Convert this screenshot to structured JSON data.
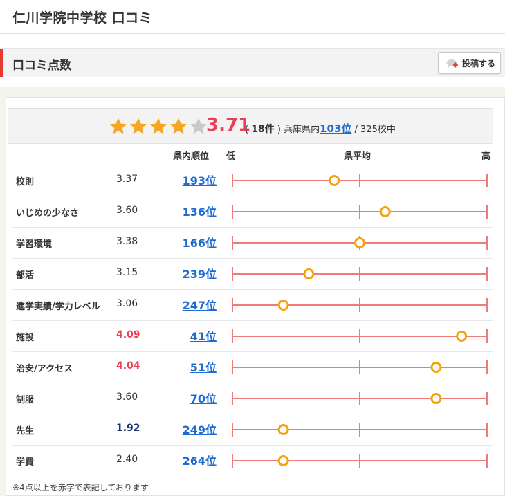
{
  "page": {
    "title": "仁川学院中学校 口コミ"
  },
  "section": {
    "title": "口コミ点数",
    "post_button_label": "投稿する"
  },
  "summary": {
    "star_rating": 3.71,
    "score": "3.71",
    "count_open": "(",
    "count": "18件",
    "count_close": ")",
    "prefecture": "兵庫県内",
    "rank": "103位",
    "total": "/ 325校中"
  },
  "columns": {
    "rank": "県内順位",
    "low": "低",
    "average": "県平均",
    "high": "高"
  },
  "colors": {
    "high_score": "#ea3f57",
    "low_score": "#1a2f6e",
    "rank_link": "#1d6bd1",
    "chart_line": "#f0797a",
    "marker": "#f5a30d",
    "star_filled": "#f5a623",
    "star_empty": "#c9c9c9"
  },
  "rows": [
    {
      "label": "校則",
      "score": "3.37",
      "rank": "193位",
      "level": "normal",
      "position": 0.4
    },
    {
      "label": "いじめの少なさ",
      "score": "3.60",
      "rank": "136位",
      "level": "normal",
      "position": 0.6
    },
    {
      "label": "学習環境",
      "score": "3.38",
      "rank": "166位",
      "level": "normal",
      "position": 0.5
    },
    {
      "label": "部活",
      "score": "3.15",
      "rank": "239位",
      "level": "normal",
      "position": 0.3
    },
    {
      "label": "進学実績/学力レベル",
      "score": "3.06",
      "rank": "247位",
      "level": "normal",
      "position": 0.2
    },
    {
      "label": "施設",
      "score": "4.09",
      "rank": "41位",
      "level": "high",
      "position": 0.9
    },
    {
      "label": "治安/アクセス",
      "score": "4.04",
      "rank": "51位",
      "level": "high",
      "position": 0.8
    },
    {
      "label": "制服",
      "score": "3.60",
      "rank": "70位",
      "level": "normal",
      "position": 0.8
    },
    {
      "label": "先生",
      "score": "1.92",
      "rank": "249位",
      "level": "low",
      "position": 0.2
    },
    {
      "label": "学費",
      "score": "2.40",
      "rank": "264位",
      "level": "normal",
      "position": 0.2
    }
  ],
  "footnote": "※4点以上を赤字で表記しております"
}
